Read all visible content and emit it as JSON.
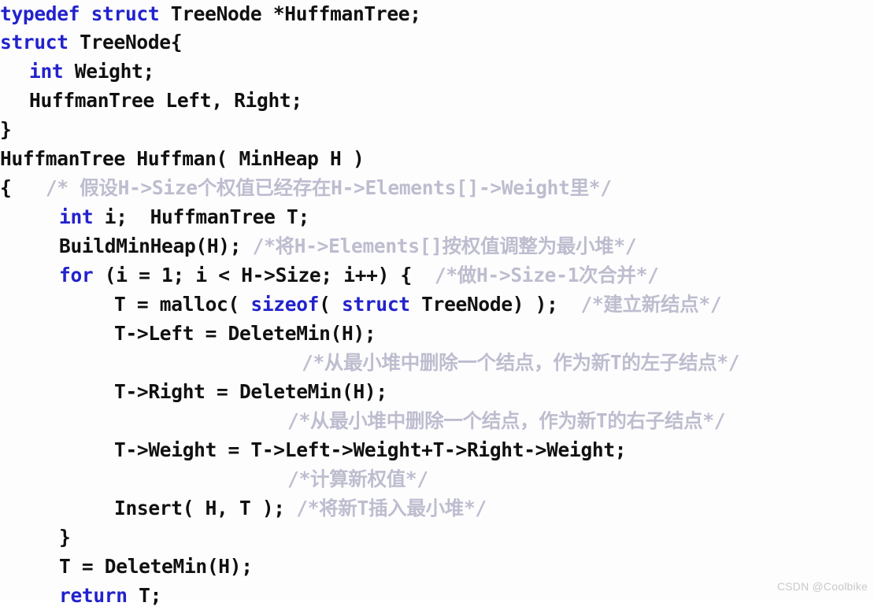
{
  "document": {
    "kind": "code-listing",
    "language": "C",
    "title": "Huffman Tree construction code",
    "background_color": "#fdfdfe",
    "keyword_color": "#2222cc",
    "code_color": "#101010",
    "comment_color": "#bdbdcf",
    "watermark": "CSDN @Coolbike"
  },
  "lines": [
    {
      "id": "line-1",
      "indent": 0,
      "segments": [
        {
          "kind": "keyword",
          "text": "typedef"
        },
        {
          "kind": "code",
          "text": " "
        },
        {
          "kind": "keyword",
          "text": "struct"
        },
        {
          "kind": "code",
          "text": " TreeNode *HuffmanTree;"
        }
      ]
    },
    {
      "id": "line-2",
      "indent": 0,
      "segments": [
        {
          "kind": "keyword",
          "text": "struct"
        },
        {
          "kind": "code",
          "text": " TreeNode{"
        }
      ]
    },
    {
      "id": "line-3",
      "indent": 1,
      "segments": [
        {
          "kind": "keyword",
          "text": "int"
        },
        {
          "kind": "code",
          "text": " Weight;"
        }
      ]
    },
    {
      "id": "line-4",
      "indent": 1,
      "segments": [
        {
          "kind": "code",
          "text": "HuffmanTree Left, Right;"
        }
      ]
    },
    {
      "id": "line-5",
      "indent": 0,
      "segments": [
        {
          "kind": "code",
          "text": "}"
        }
      ]
    },
    {
      "id": "line-6",
      "indent": 0,
      "segments": [
        {
          "kind": "code",
          "text": "HuffmanTree Huffman( MinHeap H )"
        }
      ]
    },
    {
      "id": "line-7",
      "indent": 0,
      "segments": [
        {
          "kind": "code",
          "text": "{   "
        },
        {
          "kind": "comment",
          "text": "/* 假设H->Size个权值已经存在H->Elements[]->Weight里*/"
        }
      ]
    },
    {
      "id": "line-8",
      "indent": 2,
      "segments": [
        {
          "kind": "keyword",
          "text": "int"
        },
        {
          "kind": "code",
          "text": " i;  HuffmanTree T;"
        }
      ]
    },
    {
      "id": "line-9",
      "indent": 2,
      "segments": [
        {
          "kind": "code",
          "text": "BuildMinHeap(H); "
        },
        {
          "kind": "comment",
          "text": "/*将H->Elements[]按权值调整为最小堆*/"
        }
      ]
    },
    {
      "id": "line-10",
      "indent": 2,
      "segments": [
        {
          "kind": "keyword",
          "text": "for"
        },
        {
          "kind": "code",
          "text": " (i = 1; i < H->Size; i++) {  "
        },
        {
          "kind": "comment",
          "text": "/*做H->Size-1次合并*/"
        }
      ]
    },
    {
      "id": "line-11",
      "indent": 3,
      "segments": [
        {
          "kind": "code",
          "text": "T = malloc( "
        },
        {
          "kind": "keyword",
          "text": "sizeof"
        },
        {
          "kind": "code",
          "text": "( "
        },
        {
          "kind": "keyword",
          "text": "struct"
        },
        {
          "kind": "code",
          "text": " TreeNode) );  "
        },
        {
          "kind": "comment",
          "text": "/*建立新结点*/"
        }
      ]
    },
    {
      "id": "line-12",
      "indent": 3,
      "segments": [
        {
          "kind": "code",
          "text": "T->Left = DeleteMin(H);"
        }
      ]
    },
    {
      "id": "line-13",
      "indent": "comment-1",
      "segments": [
        {
          "kind": "comment",
          "text": "/*从最小堆中删除一个结点，作为新T的左子结点*/"
        }
      ]
    },
    {
      "id": "line-14",
      "indent": 3,
      "segments": [
        {
          "kind": "code",
          "text": "T->Right = DeleteMin(H);"
        }
      ]
    },
    {
      "id": "line-15",
      "indent": "comment-2",
      "segments": [
        {
          "kind": "comment",
          "text": "/*从最小堆中删除一个结点，作为新T的右子结点*/"
        }
      ]
    },
    {
      "id": "line-16",
      "indent": 3,
      "segments": [
        {
          "kind": "code",
          "text": "T->Weight = T->Left->Weight+T->Right->Weight;"
        }
      ]
    },
    {
      "id": "line-17",
      "indent": "comment-3",
      "segments": [
        {
          "kind": "comment",
          "text": "/*计算新权值*/"
        }
      ]
    },
    {
      "id": "line-18",
      "indent": 3,
      "segments": [
        {
          "kind": "code",
          "text": "Insert( H, T ); "
        },
        {
          "kind": "comment",
          "text": "/*将新T插入最小堆*/"
        }
      ]
    },
    {
      "id": "line-19",
      "indent": 2,
      "segments": [
        {
          "kind": "code",
          "text": "}"
        }
      ]
    },
    {
      "id": "line-20",
      "indent": 2,
      "segments": [
        {
          "kind": "code",
          "text": "T = DeleteMin(H);"
        }
      ]
    },
    {
      "id": "line-21",
      "indent": 2,
      "segments": [
        {
          "kind": "keyword",
          "text": "return"
        },
        {
          "kind": "code",
          "text": " T;"
        }
      ]
    }
  ]
}
